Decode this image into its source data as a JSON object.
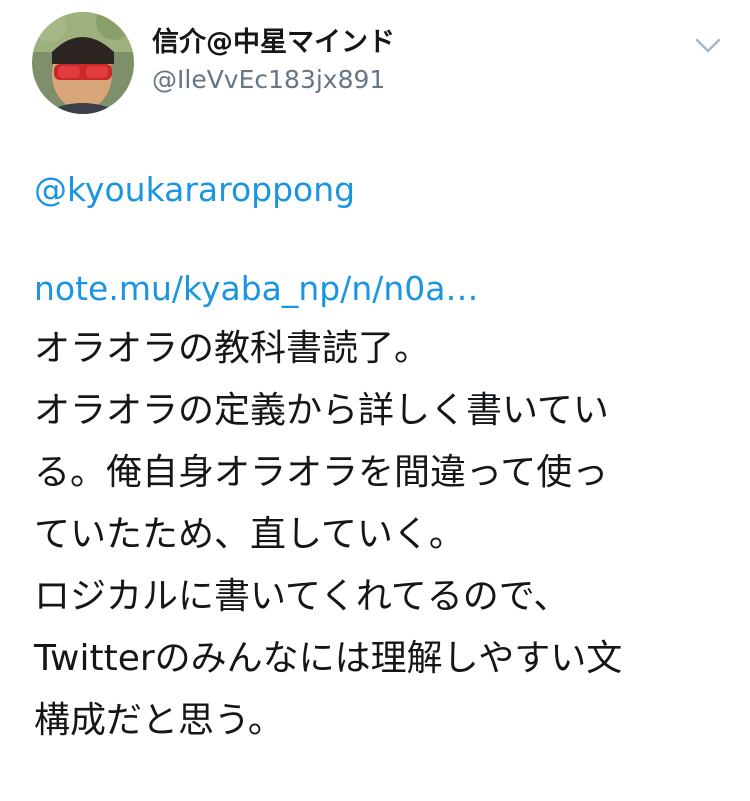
{
  "user": {
    "display_name": "信介@中星マインド",
    "handle": "@IleVvEc183jx891"
  },
  "tweet": {
    "mention": "@kyoukararoppong",
    "link": "note.mu/kyaba_np/n/n0a…",
    "lines": [
      "オラオラの教科書読了。",
      "オラオラの定義から詳しく書いてい",
      "る。俺自身オラオラを間違って使っ",
      "ていたため、直していく。",
      "ロジカルに書いてくれてるので、",
      "Twitterのみんなには理解しやすい文",
      "構成だと思う。"
    ]
  },
  "icons": {
    "menu": "chevron-down-icon",
    "avatar": "avatar"
  },
  "colors": {
    "link": "#1b95e0",
    "text": "#14171a",
    "secondary": "#657786"
  }
}
